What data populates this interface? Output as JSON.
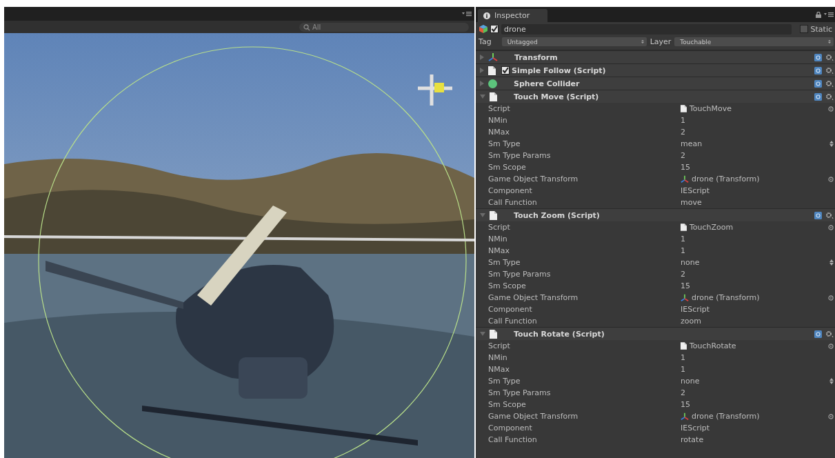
{
  "scene": {
    "search": {
      "placeholder": "All"
    }
  },
  "inspector": {
    "tab": "Inspector",
    "object": {
      "name": "drone",
      "active": true,
      "static_label": "Static",
      "static": false
    },
    "tag_label": "Tag",
    "tag": "Untagged",
    "layer_label": "Layer",
    "layer": "Touchable",
    "components": [
      {
        "kind": "transform",
        "name": "Transform",
        "expanded": false
      },
      {
        "kind": "script",
        "name": "Simple Follow (Script)",
        "expanded": false,
        "checked": true
      },
      {
        "kind": "collider",
        "name": "Sphere Collider",
        "expanded": false
      },
      {
        "kind": "script",
        "name": "Touch Move (Script)",
        "expanded": true,
        "properties": [
          {
            "label": "Script",
            "value": "TouchMove",
            "kind": "script"
          },
          {
            "label": "NMin",
            "value": "1",
            "kind": "text"
          },
          {
            "label": "NMax",
            "value": "2",
            "kind": "text"
          },
          {
            "label": "Sm Type",
            "value": "mean",
            "kind": "dropdown"
          },
          {
            "label": "Sm Type Params",
            "value": "2",
            "kind": "text"
          },
          {
            "label": "Sm Scope",
            "value": "15",
            "kind": "text"
          },
          {
            "label": "Game Object Transform",
            "value": "drone (Transform)",
            "kind": "transform"
          },
          {
            "label": "Component",
            "value": "IEScript",
            "kind": "text"
          },
          {
            "label": "Call Function",
            "value": "move",
            "kind": "text"
          }
        ]
      },
      {
        "kind": "script",
        "name": "Touch Zoom (Script)",
        "expanded": true,
        "properties": [
          {
            "label": "Script",
            "value": "TouchZoom",
            "kind": "script"
          },
          {
            "label": "NMin",
            "value": "1",
            "kind": "text"
          },
          {
            "label": "NMax",
            "value": "1",
            "kind": "text"
          },
          {
            "label": "Sm Type",
            "value": "none",
            "kind": "dropdown"
          },
          {
            "label": "Sm Type Params",
            "value": "2",
            "kind": "text"
          },
          {
            "label": "Sm Scope",
            "value": "15",
            "kind": "text"
          },
          {
            "label": "Game Object Transform",
            "value": "drone (Transform)",
            "kind": "transform"
          },
          {
            "label": "Component",
            "value": "IEScript",
            "kind": "text"
          },
          {
            "label": "Call Function",
            "value": "zoom",
            "kind": "text"
          }
        ]
      },
      {
        "kind": "script",
        "name": "Touch Rotate (Script)",
        "expanded": true,
        "properties": [
          {
            "label": "Script",
            "value": "TouchRotate",
            "kind": "script"
          },
          {
            "label": "NMin",
            "value": "1",
            "kind": "text"
          },
          {
            "label": "NMax",
            "value": "1",
            "kind": "text"
          },
          {
            "label": "Sm Type",
            "value": "none",
            "kind": "dropdown"
          },
          {
            "label": "Sm Type Params",
            "value": "2",
            "kind": "text"
          },
          {
            "label": "Sm Scope",
            "value": "15",
            "kind": "text"
          },
          {
            "label": "Game Object Transform",
            "value": "drone (Transform)",
            "kind": "transform"
          },
          {
            "label": "Component",
            "value": "IEScript",
            "kind": "text"
          },
          {
            "label": "Call Function",
            "value": "rotate",
            "kind": "text"
          }
        ]
      }
    ]
  }
}
